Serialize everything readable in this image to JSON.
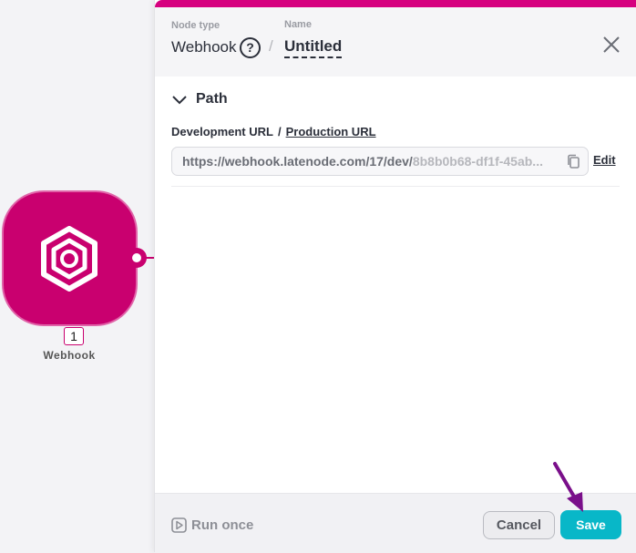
{
  "canvas": {
    "node": {
      "number": "1",
      "label": "Webhook",
      "color": "#c9006f",
      "icon": "webhook-hexagon-icon"
    }
  },
  "panel": {
    "accent_color": "#d6007f",
    "header": {
      "node_type_label": "Node type",
      "node_type_value": "Webhook",
      "name_label": "Name",
      "name_value": "Untitled",
      "separator": "/"
    },
    "section": {
      "title": "Path"
    },
    "url_tabs": {
      "development": "Development URL",
      "separator": "/",
      "production": "Production URL"
    },
    "url": {
      "base": "https://webhook.latenode.com/17/dev/",
      "token": "8b8b0b68-df1f-45ab..."
    },
    "edit_label": "Edit",
    "footer": {
      "run_once_label": "Run once",
      "cancel_label": "Cancel",
      "save_label": "Save",
      "save_color": "#08b7c8"
    },
    "annotation_arrow_color": "#7a0f8a"
  }
}
